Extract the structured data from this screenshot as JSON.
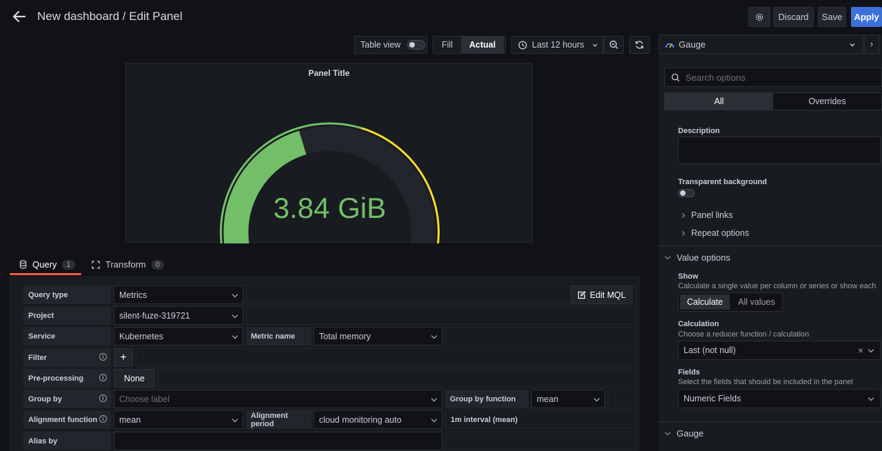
{
  "header": {
    "title": "New dashboard / Edit Panel",
    "discard": "Discard",
    "save": "Save",
    "apply": "Apply"
  },
  "toolbar": {
    "table_view": "Table view",
    "fill": "Fill",
    "actual": "Actual",
    "time_range": "Last 12 hours"
  },
  "panel": {
    "title": "Panel Title",
    "value": "3.84 GiB",
    "gauge_fraction": 0.43,
    "threshold_fraction": 0.57,
    "colors": {
      "value": "#73bf69",
      "threshold": "#fade2a",
      "track": "#22252b"
    }
  },
  "tabs": {
    "query": "Query",
    "query_count": "1",
    "transform": "Transform",
    "transform_count": "0"
  },
  "query": {
    "query_type_label": "Query type",
    "query_type": "Metrics",
    "edit_mql": "Edit MQL",
    "project_label": "Project",
    "project": "silent-fuze-319721",
    "service_label": "Service",
    "service": "Kubernetes",
    "metric_name_label": "Metric name",
    "metric_name": "Total memory",
    "filter_label": "Filter",
    "preprocessing_label": "Pre-processing",
    "preprocessing": "None",
    "group_by_label": "Group by",
    "group_by_placeholder": "Choose label",
    "group_by_function_label": "Group by function",
    "group_by_function": "mean",
    "alignment_function_label": "Alignment function",
    "alignment_function": "mean",
    "alignment_period_label": "Alignment period",
    "alignment_period": "cloud monitoring auto",
    "interval_note": "1m interval (mean)",
    "alias_by_label": "Alias by"
  },
  "options": {
    "visualization": "Gauge",
    "search_placeholder": "Search options",
    "tab_all": "All",
    "tab_overrides": "Overrides",
    "description_label": "Description",
    "transparent_label": "Transparent background",
    "panel_links": "Panel links",
    "repeat_options": "Repeat options",
    "value_options": "Value options",
    "show_label": "Show",
    "show_desc": "Calculate a single value per column or series or show each row",
    "calculate": "Calculate",
    "all_values": "All values",
    "calculation_label": "Calculation",
    "calculation_desc": "Choose a reducer function / calculation",
    "calculation_value": "Last (not null)",
    "fields_label": "Fields",
    "fields_desc": "Select the fields that should be included in the panel",
    "fields_value": "Numeric Fields",
    "gauge_section": "Gauge"
  }
}
